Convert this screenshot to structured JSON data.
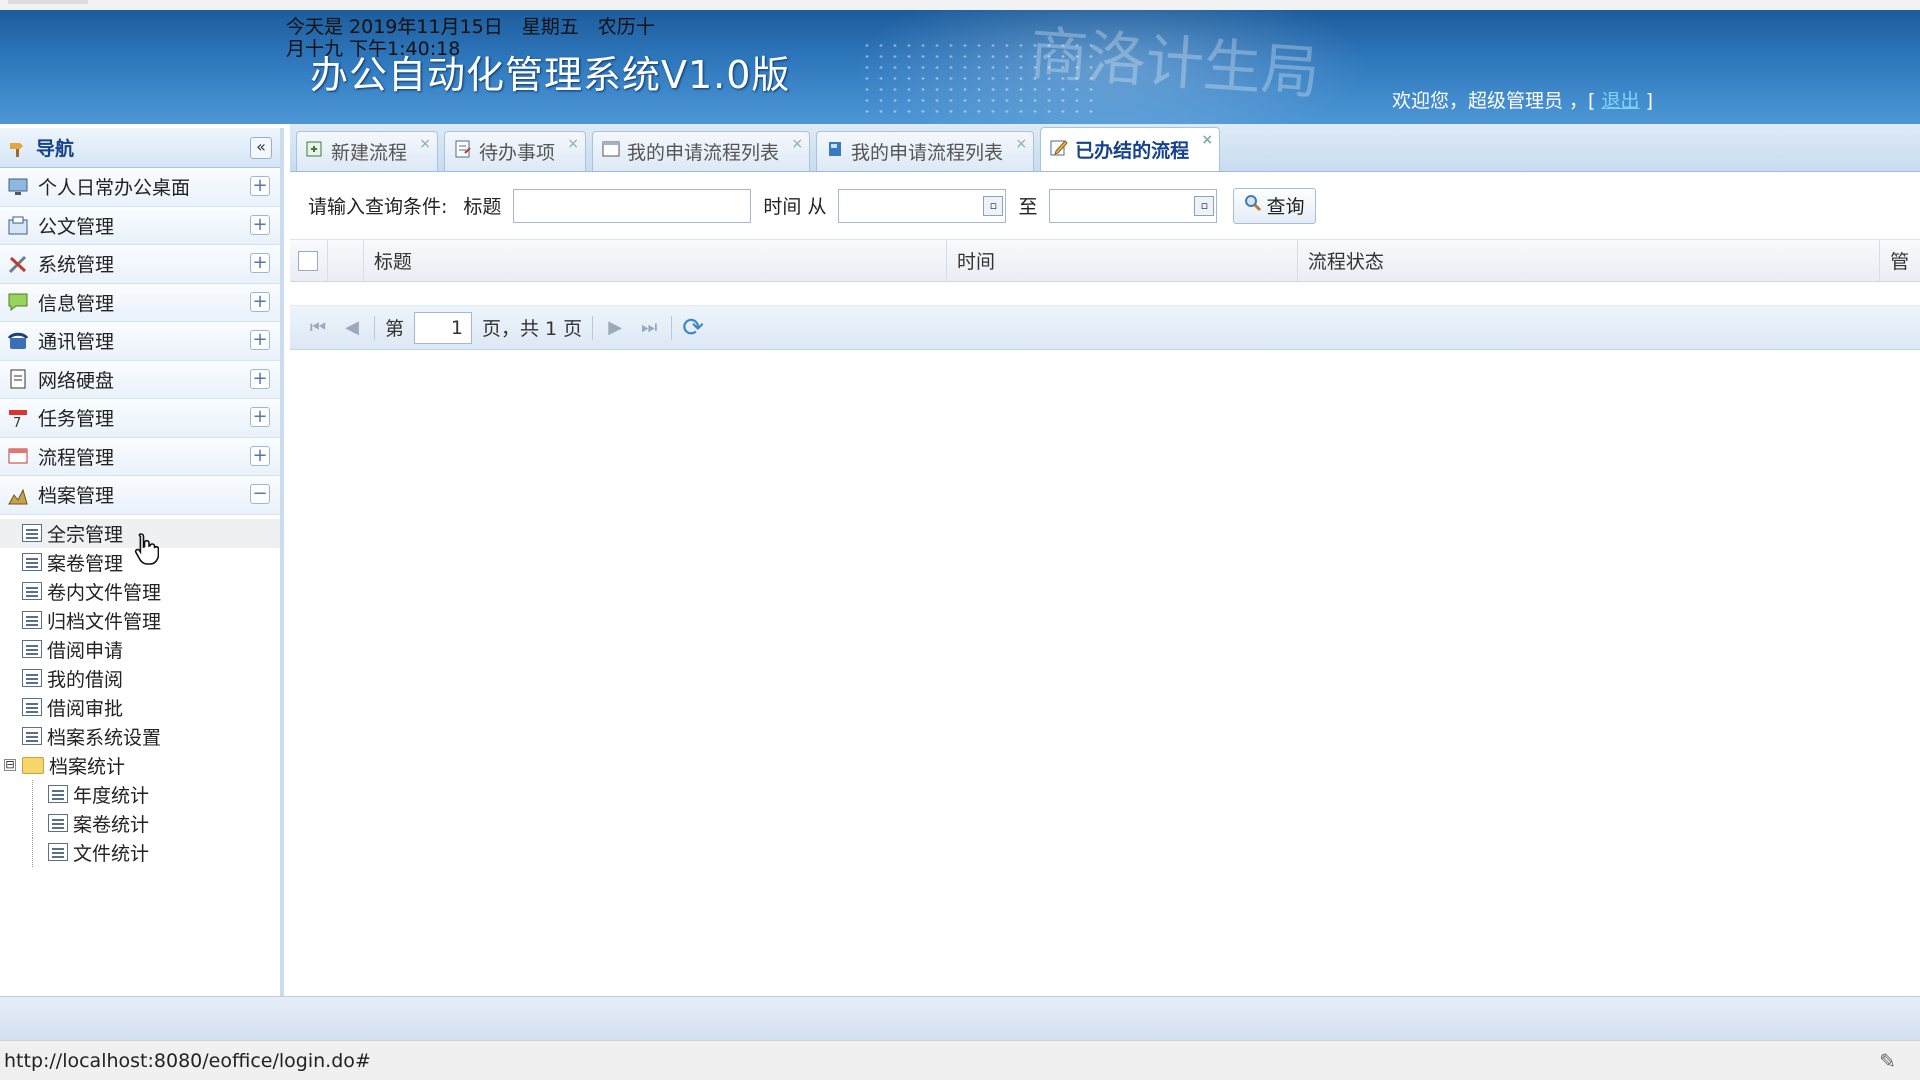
{
  "header": {
    "date_line": "今天是 2019年11月15日　星期五　农历十",
    "time_line": "月十九 下午1:40:18",
    "app_title": "办公自动化管理系统V1.0版",
    "watermark": "商洛计生局",
    "welcome": "欢迎您，超级管理员 ，[",
    "logout": "退出",
    "welcome_end": "]"
  },
  "nav": {
    "title": "导航",
    "collapse": "«",
    "menus": [
      {
        "label": "个人日常办公桌面",
        "icon": "monitor-icon",
        "toggle": "+"
      },
      {
        "label": "公文管理",
        "icon": "document-folder-icon",
        "toggle": "+"
      },
      {
        "label": "系统管理",
        "icon": "tools-icon",
        "toggle": "+"
      },
      {
        "label": "信息管理",
        "icon": "chat-bubble-icon",
        "toggle": "+"
      },
      {
        "label": "通讯管理",
        "icon": "phone-icon",
        "toggle": "+"
      },
      {
        "label": "网络硬盘",
        "icon": "page-icon",
        "toggle": "+"
      },
      {
        "label": "任务管理",
        "icon": "calendar-icon",
        "toggle": "+"
      },
      {
        "label": "流程管理",
        "icon": "window-icon",
        "toggle": "+"
      },
      {
        "label": "档案管理",
        "icon": "chart-icon",
        "toggle": "−"
      }
    ],
    "tree": [
      "全宗管理",
      "案卷管理",
      "卷内文件管理",
      "归档文件管理",
      "借阅申请",
      "我的借阅",
      "借阅审批",
      "档案系统设置"
    ],
    "tree_folder": {
      "label": "档案统计",
      "toggle": "⊟"
    },
    "tree_sub": [
      "年度统计",
      "案卷统计",
      "文件统计"
    ]
  },
  "tabs": [
    {
      "label": "新建流程",
      "icon": "new-flow-icon",
      "active": false
    },
    {
      "label": "待办事项",
      "icon": "todo-icon",
      "active": false
    },
    {
      "label": "我的申请流程列表",
      "icon": "list-icon",
      "active": false
    },
    {
      "label": "我的申请流程列表",
      "icon": "book-icon",
      "active": false
    },
    {
      "label": "已办结的流程",
      "icon": "edit-icon",
      "active": true
    }
  ],
  "search": {
    "prompt": "请输入查询条件:",
    "title_label": "标题",
    "time_label": "时间 从",
    "to_label": "至",
    "button": "查询"
  },
  "grid": {
    "columns": [
      "标题",
      "时间",
      "流程状态",
      "管"
    ]
  },
  "pager": {
    "page_prefix": "第",
    "page_value": "1",
    "page_suffix": "页，共 1 页"
  },
  "status": {
    "url": "http://localhost:8080/eoffice/login.do#"
  },
  "colors": {
    "header_bg": "#2f78bd",
    "nav_border": "#c9dcef",
    "active_tab_text": "#15428b",
    "logout_link": "#7fd3ff"
  }
}
